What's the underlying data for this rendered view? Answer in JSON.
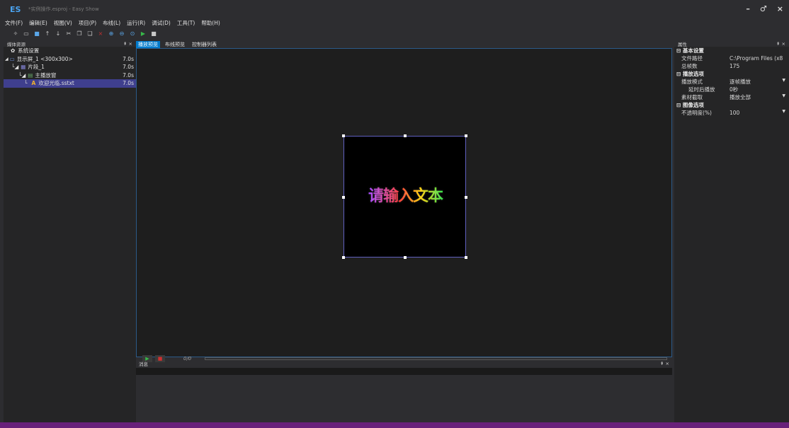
{
  "app": {
    "logo": "ES",
    "title": "*实例操作.esproj - Easy Show"
  },
  "window_controls": {
    "minimize": "–",
    "maximize": "♂",
    "close": "×"
  },
  "menu": [
    "文件(F)",
    "编辑(E)",
    "视图(V)",
    "项目(P)",
    "布线(L)",
    "运行(R)",
    "调试(D)",
    "工具(T)",
    "帮助(H)"
  ],
  "toolbar": {
    "icons": [
      "new-project-icon",
      "open-icon",
      "save-icon",
      "move-up-icon",
      "move-down-icon",
      "cut-icon",
      "copy-icon",
      "paste-icon",
      "delete-icon",
      "zoom-in-icon",
      "zoom-out-icon",
      "zoom-fit-icon",
      "play-icon",
      "stop-icon"
    ]
  },
  "media_panel": {
    "title": "媒体资源",
    "pin": "⇞",
    "close": "×",
    "items": [
      {
        "label": "系统设置",
        "duration": ""
      },
      {
        "label": "显示屏_1 <300x300>",
        "duration": "7.0s"
      },
      {
        "label": "片段_1",
        "duration": "7.0s"
      },
      {
        "label": "主播放窗",
        "duration": "7.0s"
      },
      {
        "label": "欢迎光临.sstxt",
        "duration": "7.0s"
      }
    ]
  },
  "tabs": [
    {
      "label": "播放预览",
      "active": true
    },
    {
      "label": "布线预览",
      "active": false
    },
    {
      "label": "控制器列表",
      "active": false
    }
  ],
  "stage": {
    "text": "请输入文本"
  },
  "playback": {
    "time": "0/0",
    "play": "▶",
    "stop": "■"
  },
  "message_panel": {
    "title": "消息",
    "pin": "⇞",
    "close": "×"
  },
  "property_panel": {
    "title": "属性",
    "pin": "⇞",
    "close": "×",
    "sections": [
      {
        "title": "基本设置",
        "rows": [
          {
            "key": "文件路径",
            "value": "C:\\Program Files (x8"
          },
          {
            "key": "总帧数",
            "value": "175"
          }
        ]
      },
      {
        "title": "播放选项",
        "rows": [
          {
            "key": "播放模式",
            "value": "逐帧播放",
            "dropdown": true
          },
          {
            "key": "延时后播放",
            "value": "0秒",
            "indent": true
          },
          {
            "key": "素材截取",
            "value": "播放全部",
            "dropdown": true
          }
        ]
      },
      {
        "title": "图像选项",
        "rows": [
          {
            "key": "不透明度(%)",
            "value": "100",
            "dropdown": true
          }
        ]
      }
    ]
  },
  "colors": {
    "accent": "#007acc",
    "status_bar": "#68217a",
    "selection": "#3f3f8e"
  }
}
